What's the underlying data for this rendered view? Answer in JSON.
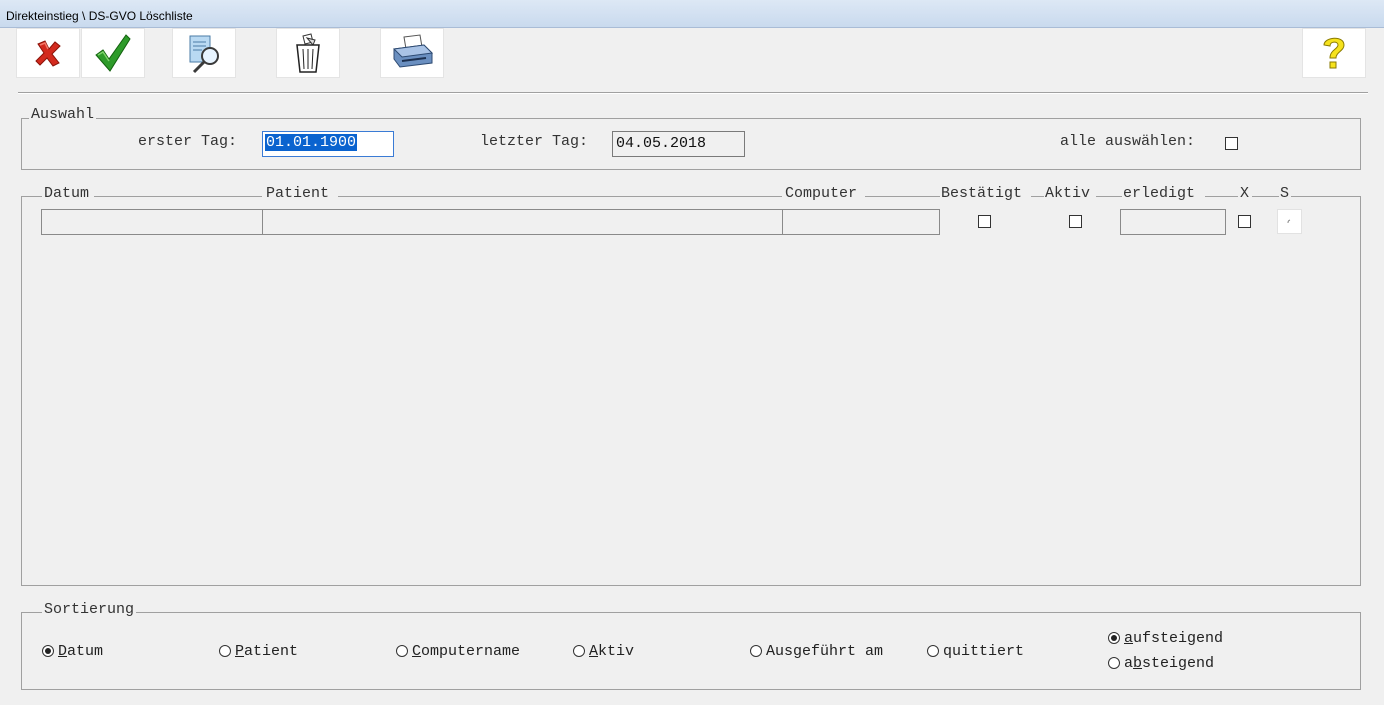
{
  "window": {
    "title": "Direkteinstieg \\ DS-GVO Löschliste"
  },
  "toolbar": {
    "buttons": [
      {
        "icon": "cancel-icon"
      },
      {
        "icon": "ok-checkmark-icon"
      },
      {
        "icon": "document-search-icon"
      },
      {
        "icon": "trash-bin-icon"
      },
      {
        "icon": "printer-icon"
      },
      {
        "icon": "help-question-icon"
      }
    ]
  },
  "auswahl": {
    "legend": "Auswahl",
    "first_day_label": "erster Tag:",
    "first_day_value": "01.01.1900",
    "last_day_label": "letzter Tag:",
    "last_day_value": "04.05.2018",
    "select_all_label": "alle auswählen:",
    "select_all_checked": false
  },
  "table": {
    "columns": [
      "Datum",
      "Patient",
      "Computer",
      "Bestätigt",
      "Aktiv",
      "erledigt",
      "X",
      "S"
    ],
    "rows": [
      {
        "datum": "",
        "patient": "",
        "computer": "",
        "bestaetigt": false,
        "aktiv": false,
        "erledigt": "",
        "x": false
      }
    ]
  },
  "sortierung": {
    "legend": "Sortierung",
    "options": [
      {
        "pre": "",
        "hot": "D",
        "post": "atum",
        "selected": true
      },
      {
        "pre": "",
        "hot": "P",
        "post": "atient",
        "selected": false
      },
      {
        "pre": "",
        "hot": "C",
        "post": "omputername",
        "selected": false
      },
      {
        "pre": "",
        "hot": "A",
        "post": "ktiv",
        "selected": false
      },
      {
        "pre": "Ausgeführt am",
        "hot": "",
        "post": "",
        "selected": false
      },
      {
        "pre": "quittiert",
        "hot": "",
        "post": "",
        "selected": false
      }
    ],
    "order": [
      {
        "pre": "",
        "hot": "a",
        "post": "ufsteigend",
        "selected": true
      },
      {
        "pre": "a",
        "hot": "b",
        "post": "steigend",
        "selected": false
      }
    ]
  }
}
